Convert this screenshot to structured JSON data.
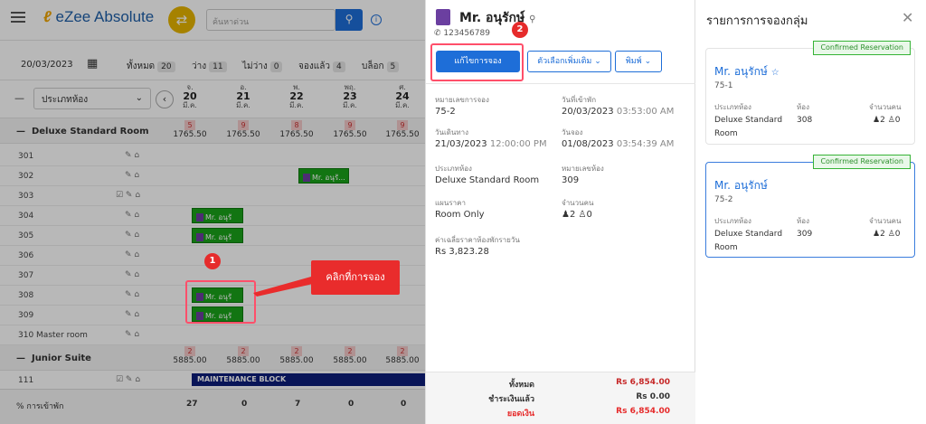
{
  "app": {
    "logo": "eZee Absolute",
    "search_placeholder": "ค้นหาด่วน"
  },
  "bar": {
    "date": "20/03/2023",
    "total_label": "ทั้งหมด",
    "total": "20",
    "vacant_label": "ว่าง",
    "vacant": "11",
    "occupied_label": "ไม่ว่าง",
    "occupied": "0",
    "reserved_label": "จองแล้ว",
    "reserved": "4",
    "blocked_label": "บล็อก",
    "blocked": "5"
  },
  "grid": {
    "room_type_select": "ประเภทห้อง",
    "days": [
      {
        "dow": "จ.",
        "day": "20",
        "mon": "มี.ค."
      },
      {
        "dow": "อ.",
        "day": "21",
        "mon": "มี.ค."
      },
      {
        "dow": "พ.",
        "day": "22",
        "mon": "มี.ค."
      },
      {
        "dow": "พฤ.",
        "day": "23",
        "mon": "มี.ค."
      },
      {
        "dow": "ศ.",
        "day": "24",
        "mon": "มี.ค."
      }
    ],
    "cat1": "Deluxe Standard Room",
    "cat1_avail": [
      "5",
      "9",
      "8",
      "9",
      "9"
    ],
    "cat1_price": [
      "1765.50",
      "1765.50",
      "1765.50",
      "1765.50",
      "1765.50"
    ],
    "rooms1": [
      "301",
      "302",
      "303",
      "304",
      "305",
      "306",
      "307",
      "308",
      "309",
      "310 Master room"
    ],
    "cat2": "Junior Suite",
    "cat2_avail": [
      "2",
      "2",
      "2",
      "2",
      "2"
    ],
    "cat2_price": [
      "5885.00",
      "5885.00",
      "5885.00",
      "5885.00",
      "5885.00"
    ],
    "rooms2": [
      "111"
    ],
    "booking_label": "Mr. อนุรั...",
    "booking_label_short": "Mr. อนุรั",
    "maintenance": "MAINTENANCE BLOCK",
    "footer_label": "% การเข้าพัก",
    "footer_vals": [
      "27",
      "0",
      "7",
      "0",
      "0"
    ]
  },
  "annotations": {
    "marker1": "1",
    "marker2": "2",
    "callout": "คลิกที่การจอง"
  },
  "detail": {
    "guest": "Mr. อนุรักษ์",
    "phone": "123456789",
    "edit_btn": "แก้ไขการจอง",
    "more_btn": "ตัวเลือกเพิ่มเติม",
    "print_btn": "พิมพ์",
    "res_no_label": "หมายเลขการจอง",
    "res_no": "75-2",
    "checkin_label": "วันที่เข้าพัก",
    "checkin_date": "20/03/2023",
    "checkin_time": "03:53:00 AM",
    "checkout_label": "วันเดินทาง",
    "checkout_date": "21/03/2023",
    "checkout_time": "12:00:00 PM",
    "booked_label": "วันจอง",
    "booked_date": "01/08/2023",
    "booked_time": "03:54:39 AM",
    "roomtype_label": "ประเภทห้อง",
    "roomtype": "Deluxe Standard Room",
    "roomno_label": "หมายเลขห้อง",
    "roomno": "309",
    "rateplan_label": "แผนราคา",
    "rateplan": "Room Only",
    "pax_label": "จำนวนคน",
    "adults": "2",
    "children": "0",
    "avg_label": "ค่าเฉลี่ยราคาห้องพักรายวัน",
    "avg": "Rs 3,823.28",
    "total_label": "ทั้งหมด",
    "total": "Rs 6,854.00",
    "paid_label": "ชำระเงินแล้ว",
    "paid": "Rs 0.00",
    "balance_label": "ยอดเงิน",
    "balance": "Rs 6,854.00"
  },
  "group": {
    "title": "รายการการจองกลุ่ม",
    "status": "Confirmed Reservation",
    "col_type": "ประเภทห้อง",
    "col_room": "ห้อง",
    "col_pax": "จำนวนคน",
    "cards": [
      {
        "name": "Mr. อนุรักษ์",
        "res": "75-1",
        "type1": "Deluxe Standard",
        "type2": "Room",
        "room": "308",
        "adults": "2",
        "children": "0"
      },
      {
        "name": "Mr. อนุรักษ์",
        "res": "75-2",
        "type1": "Deluxe Standard",
        "type2": "Room",
        "room": "309",
        "adults": "2",
        "children": "0"
      }
    ]
  },
  "colors": {
    "primary": "#1e6ed8",
    "booking": "#1aa21a",
    "confirmed": "#2c8f2c",
    "highlight": "#ff4f6a",
    "balance": "#e62b2b"
  }
}
